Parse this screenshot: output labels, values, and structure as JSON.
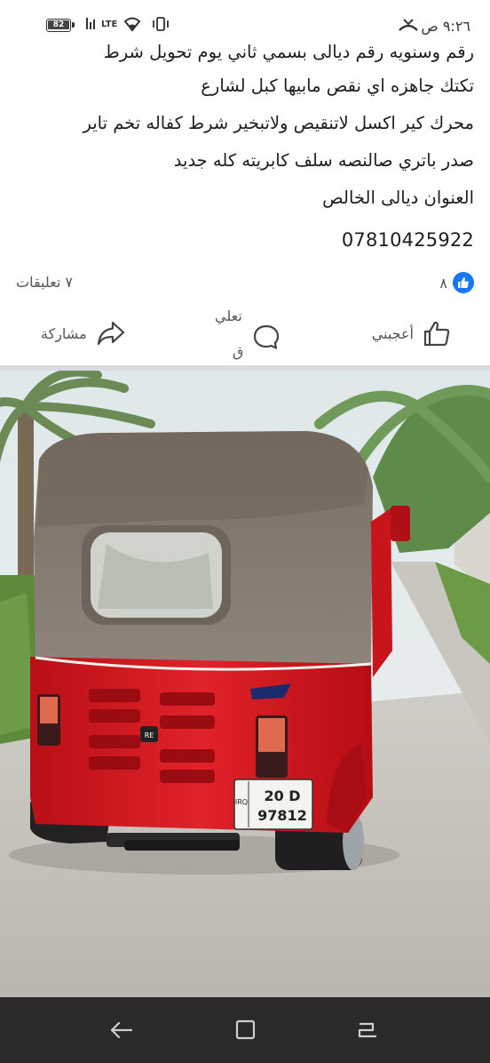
{
  "status_bar": {
    "battery": "82",
    "network": "LTE",
    "time": "٩:٢٦ ص"
  },
  "post": {
    "lines": [
      "رقم وسنويه رقم ديالى بسمي ثاني يوم تحويل شرط",
      "تكتك جاهزه اي نقص مابيها كبل لشارع",
      "محرك كير اكسل لاتنقيص ولاتبخير شرط كفاله تخم تاير",
      "صدر باتري صالنصه سلف كابريته كله جديد",
      "العنوان ديالى الخالص"
    ],
    "phone": "07810425922"
  },
  "stats": {
    "likes_count": "٨",
    "comments_text": "٧ تعليقات"
  },
  "actions": {
    "like_label": "أعجبني",
    "comment_label_1": "تعلي",
    "comment_label_2": "ق",
    "share_label": "مشاركة"
  },
  "photo": {
    "plate_top": "20 D",
    "plate_bottom": "97812",
    "plate_side": "IRQ",
    "brand_badge": "RE"
  },
  "colors": {
    "like_blue": "#1877f2",
    "rickshaw_red": "#d4141c",
    "canopy": "#8a7c70",
    "nav_bar": "#2a2a2c"
  }
}
